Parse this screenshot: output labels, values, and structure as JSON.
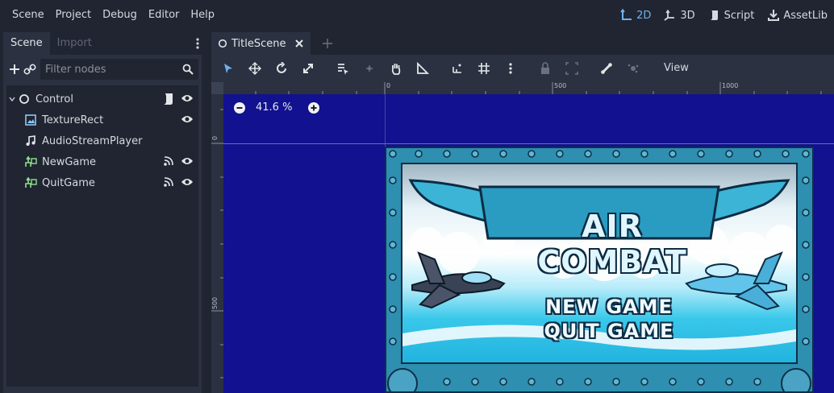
{
  "menu": [
    "Scene",
    "Project",
    "Debug",
    "Editor",
    "Help"
  ],
  "modes": {
    "mode_2d": "2D",
    "mode_3d": "3D",
    "script": "Script",
    "assetlib": "AssetLib",
    "active_color": "#6fb1ee"
  },
  "dock": {
    "tabs": {
      "scene": "Scene",
      "import": "Import"
    },
    "filter_placeholder": "Filter nodes",
    "tree": [
      {
        "label": "Control",
        "icon": "control-icon"
      },
      {
        "label": "TextureRect",
        "icon": "texture-rect-icon"
      },
      {
        "label": "AudioStreamPlayer",
        "icon": "audio-stream-icon"
      },
      {
        "label": "NewGame",
        "icon": "texture-button-icon"
      },
      {
        "label": "QuitGame",
        "icon": "texture-button-icon"
      }
    ]
  },
  "editor": {
    "tab_title": "TitleScene",
    "view_menu": "View",
    "zoom": "41.6 %"
  },
  "rulers": {
    "top": [
      "0",
      "500",
      "1000"
    ],
    "left": [
      "0",
      "500"
    ]
  },
  "game": {
    "title": "AIR COMBAT",
    "new_game": "NEW GAME",
    "quit_game": "QUIT GAME"
  },
  "colors": {
    "canvas_bg": "#12118f",
    "panel_bg": "#2b3140",
    "frame": "#2e8fb0"
  }
}
